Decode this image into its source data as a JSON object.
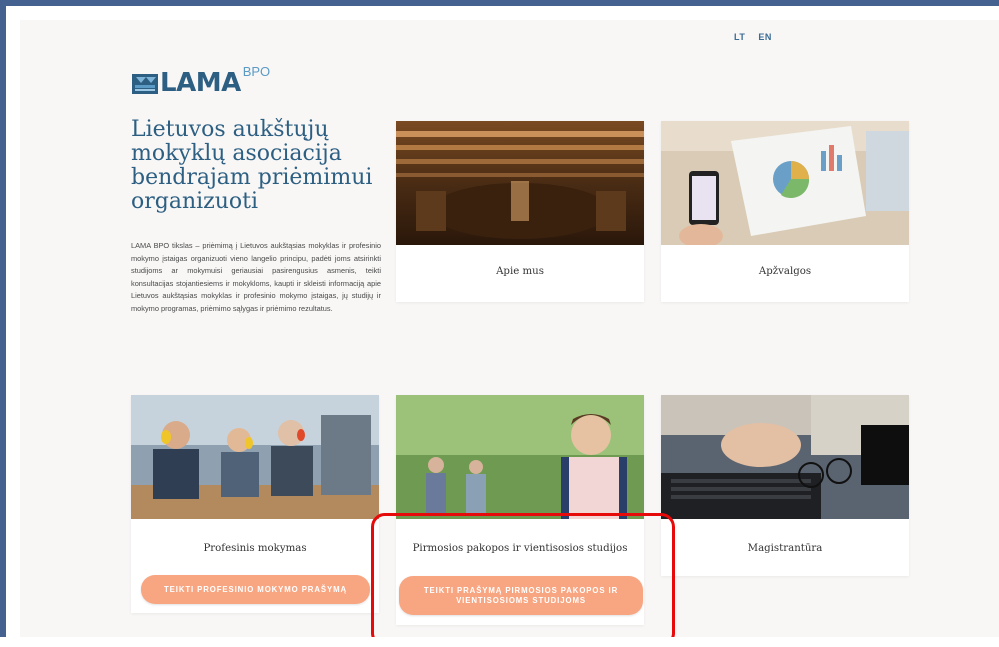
{
  "lang_switch": {
    "lt": "LT",
    "en": "EN"
  },
  "logo": {
    "name": "LAMA",
    "sup": "BPO"
  },
  "headline": "Lietuvos aukštųjų mokyklų asociacija bendrajam priėmimui organizuoti",
  "description": "LAMA BPO tikslas – priėmimą į Lietuvos aukštąsias mokyklas ir profesinio mokymo įstaigas organizuoti vieno langelio principu, padėti joms atsirinkti studijoms ar mokymuisi geriausiai pasirengusius asmenis, teikti konsultacijas stojantiesiems ir mokykloms, kaupti ir skleisti informaciją apie Lietuvos aukštąsias mokyklas ir profesinio mokymo įstaigas, jų studijų ir mokymo programas, priėmimo sąlygas ir priėmimo rezultatus.",
  "cards": {
    "apie_mus": {
      "title": "Apie mus"
    },
    "apzvalgos": {
      "title": "Apžvalgos"
    },
    "profesinis": {
      "title": "Profesinis mokymas",
      "button": "TEIKTI PROFESINIO MOKYMO PRAŠYMĄ"
    },
    "pirmosios": {
      "title": "Pirmosios pakopos ir vientisosios studijos",
      "button_line1": "TEIKTI PRAŠYMĄ PIRMOSIOS PAKOPOS IR",
      "button_line2": "VIENTISOSIOMS STUDIJOMS"
    },
    "magistrantura": {
      "title": "Magistrantūra"
    }
  },
  "colors": {
    "brand": "#2d5f82",
    "button": "#f8a682",
    "highlight": "#e60a0a",
    "frame": "#44618f"
  }
}
